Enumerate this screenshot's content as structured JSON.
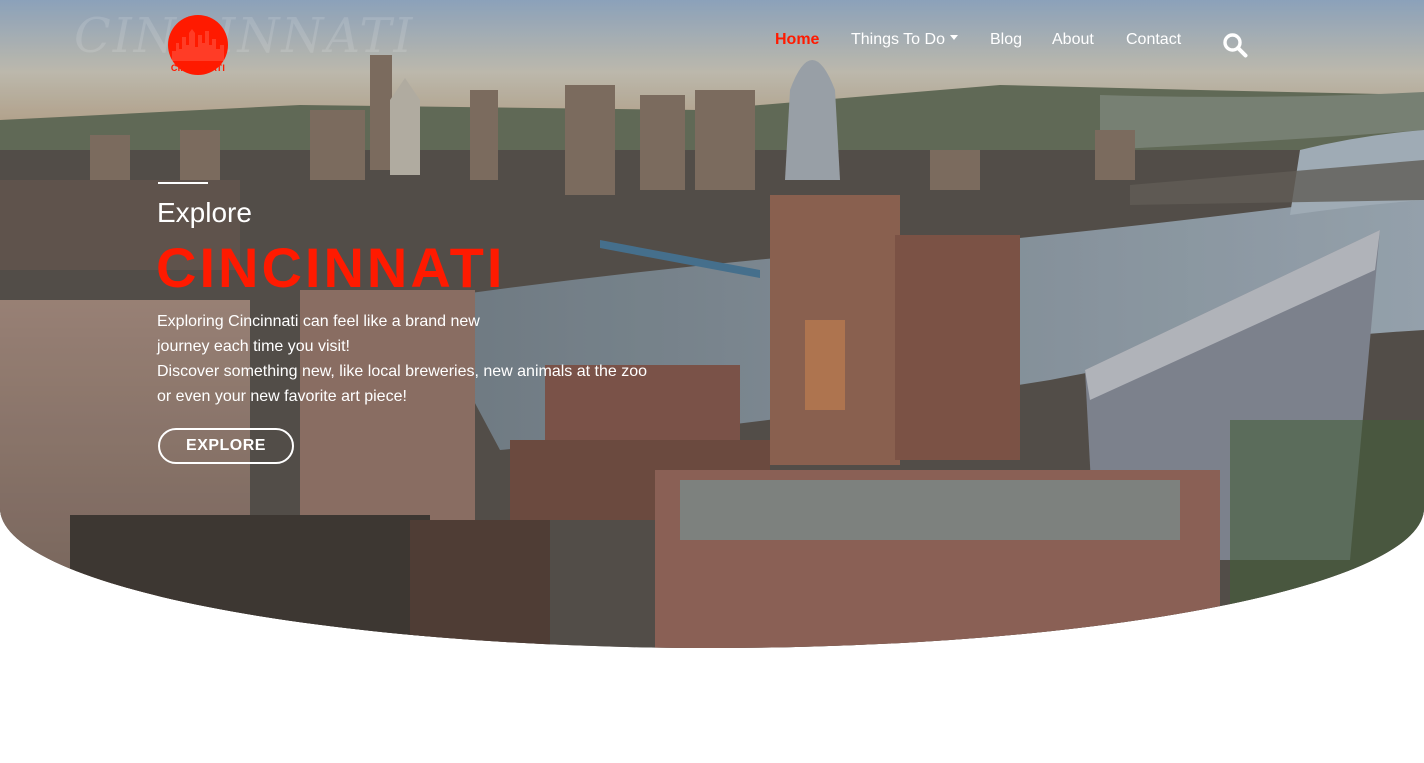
{
  "brand": {
    "logo_text": "CINCINNATI",
    "watermark": "CINCINNATI",
    "accent_color": "#ff1a00"
  },
  "nav": {
    "items": [
      {
        "label": "Home",
        "active": true
      },
      {
        "label": "Things To Do",
        "dropdown": true
      },
      {
        "label": "Blog"
      },
      {
        "label": "About"
      },
      {
        "label": "Contact"
      }
    ],
    "search_icon": "search-icon"
  },
  "hero": {
    "eyebrow": "Explore",
    "headline": "CINCINNATI",
    "description_lines": [
      "Exploring Cincinnati can feel like a brand new",
      "journey each time you visit!",
      "Discover something new, like local breweries, new animals at the zoo",
      "or even your new favorite art piece!"
    ],
    "cta_label": "EXPLORE"
  }
}
